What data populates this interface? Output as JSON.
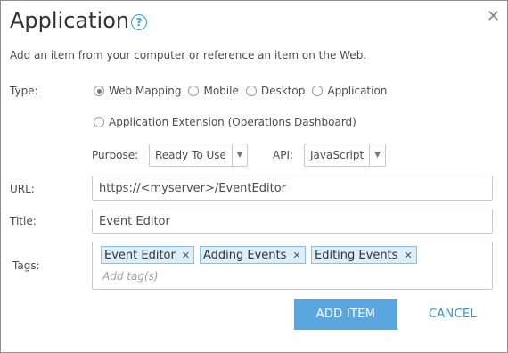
{
  "dialog": {
    "title": "Application",
    "help_glyph": "?",
    "close_glyph": "✕",
    "intro": "Add an item from your computer or reference an item on the Web."
  },
  "type_field": {
    "label": "Type:",
    "options": [
      {
        "label": "Web Mapping",
        "checked": true
      },
      {
        "label": "Mobile",
        "checked": false
      },
      {
        "label": "Desktop",
        "checked": false
      },
      {
        "label": "Application",
        "checked": false
      },
      {
        "label": "Application Extension (Operations Dashboard)",
        "checked": false
      }
    ]
  },
  "purpose": {
    "label": "Purpose:",
    "value": "Ready To Use"
  },
  "api": {
    "label": "API:",
    "value": "JavaScript"
  },
  "url": {
    "label": "URL:",
    "value": "https://<myserver>/EventEditor"
  },
  "title_field": {
    "label": "Title:",
    "value": "Event Editor"
  },
  "tags": {
    "label": "Tags:",
    "items": [
      "Event Editor",
      "Adding Events",
      "Editing Events"
    ],
    "placeholder": "Add tag(s)",
    "remove_glyph": "✕"
  },
  "buttons": {
    "add": "ADD ITEM",
    "cancel": "CANCEL"
  },
  "icons": {
    "help": "help-icon",
    "close": "close-icon",
    "dropdown": "chevron-down-icon",
    "tag_remove": "close-icon"
  },
  "colors": {
    "accent": "#5aa6de",
    "link": "#3a8fd0",
    "tag_bg": "#dbeefa"
  }
}
